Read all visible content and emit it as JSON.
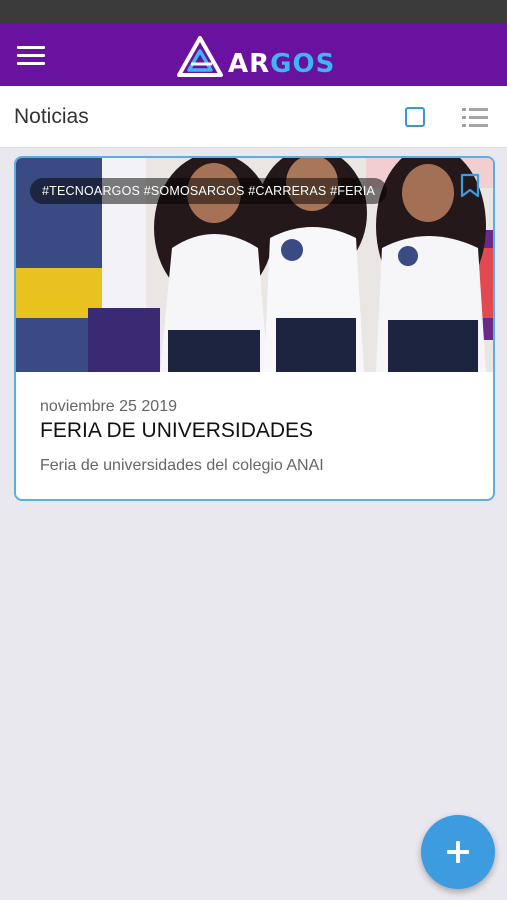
{
  "app_bar": {
    "logo_text_white": "AR",
    "logo_text_blue": "GOS",
    "menu_icon": "hamburger-menu-icon",
    "colors": {
      "app_bar": "#6a12a0",
      "logo_accent": "#3fb6f0"
    }
  },
  "subheader": {
    "title": "Noticias",
    "grid_icon": "grid-view-icon",
    "list_icon": "list-view-icon"
  },
  "news": [
    {
      "tags": "#TECNOARGOS #SOMOSARGOS #CARRERAS #FERIA",
      "date": "noviembre 25 2019",
      "title": "FERIA DE UNIVERSIDADES",
      "description": "Feria de universidades del colegio ANAI",
      "bookmark_icon": "bookmark-icon"
    }
  ],
  "fab": {
    "icon": "plus-icon",
    "color": "#3d9be0"
  }
}
